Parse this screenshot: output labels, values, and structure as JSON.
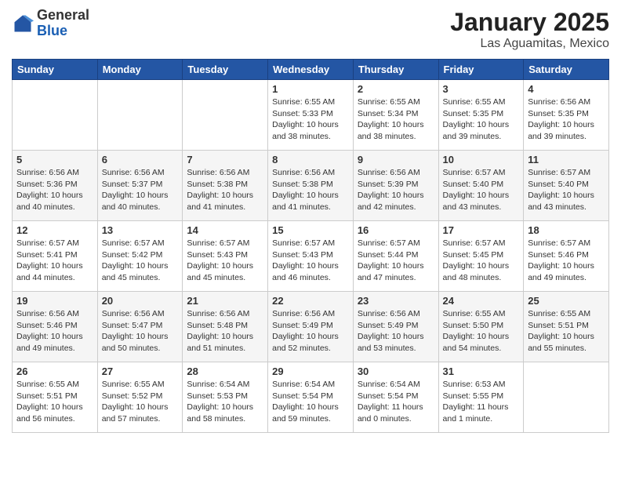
{
  "header": {
    "logo_general": "General",
    "logo_blue": "Blue",
    "month_title": "January 2025",
    "location": "Las Aguamitas, Mexico"
  },
  "days_of_week": [
    "Sunday",
    "Monday",
    "Tuesday",
    "Wednesday",
    "Thursday",
    "Friday",
    "Saturday"
  ],
  "weeks": [
    [
      {
        "day": "",
        "info": ""
      },
      {
        "day": "",
        "info": ""
      },
      {
        "day": "",
        "info": ""
      },
      {
        "day": "1",
        "info": "Sunrise: 6:55 AM\nSunset: 5:33 PM\nDaylight: 10 hours\nand 38 minutes."
      },
      {
        "day": "2",
        "info": "Sunrise: 6:55 AM\nSunset: 5:34 PM\nDaylight: 10 hours\nand 38 minutes."
      },
      {
        "day": "3",
        "info": "Sunrise: 6:55 AM\nSunset: 5:35 PM\nDaylight: 10 hours\nand 39 minutes."
      },
      {
        "day": "4",
        "info": "Sunrise: 6:56 AM\nSunset: 5:35 PM\nDaylight: 10 hours\nand 39 minutes."
      }
    ],
    [
      {
        "day": "5",
        "info": "Sunrise: 6:56 AM\nSunset: 5:36 PM\nDaylight: 10 hours\nand 40 minutes."
      },
      {
        "day": "6",
        "info": "Sunrise: 6:56 AM\nSunset: 5:37 PM\nDaylight: 10 hours\nand 40 minutes."
      },
      {
        "day": "7",
        "info": "Sunrise: 6:56 AM\nSunset: 5:38 PM\nDaylight: 10 hours\nand 41 minutes."
      },
      {
        "day": "8",
        "info": "Sunrise: 6:56 AM\nSunset: 5:38 PM\nDaylight: 10 hours\nand 41 minutes."
      },
      {
        "day": "9",
        "info": "Sunrise: 6:56 AM\nSunset: 5:39 PM\nDaylight: 10 hours\nand 42 minutes."
      },
      {
        "day": "10",
        "info": "Sunrise: 6:57 AM\nSunset: 5:40 PM\nDaylight: 10 hours\nand 43 minutes."
      },
      {
        "day": "11",
        "info": "Sunrise: 6:57 AM\nSunset: 5:40 PM\nDaylight: 10 hours\nand 43 minutes."
      }
    ],
    [
      {
        "day": "12",
        "info": "Sunrise: 6:57 AM\nSunset: 5:41 PM\nDaylight: 10 hours\nand 44 minutes."
      },
      {
        "day": "13",
        "info": "Sunrise: 6:57 AM\nSunset: 5:42 PM\nDaylight: 10 hours\nand 45 minutes."
      },
      {
        "day": "14",
        "info": "Sunrise: 6:57 AM\nSunset: 5:43 PM\nDaylight: 10 hours\nand 45 minutes."
      },
      {
        "day": "15",
        "info": "Sunrise: 6:57 AM\nSunset: 5:43 PM\nDaylight: 10 hours\nand 46 minutes."
      },
      {
        "day": "16",
        "info": "Sunrise: 6:57 AM\nSunset: 5:44 PM\nDaylight: 10 hours\nand 47 minutes."
      },
      {
        "day": "17",
        "info": "Sunrise: 6:57 AM\nSunset: 5:45 PM\nDaylight: 10 hours\nand 48 minutes."
      },
      {
        "day": "18",
        "info": "Sunrise: 6:57 AM\nSunset: 5:46 PM\nDaylight: 10 hours\nand 49 minutes."
      }
    ],
    [
      {
        "day": "19",
        "info": "Sunrise: 6:56 AM\nSunset: 5:46 PM\nDaylight: 10 hours\nand 49 minutes."
      },
      {
        "day": "20",
        "info": "Sunrise: 6:56 AM\nSunset: 5:47 PM\nDaylight: 10 hours\nand 50 minutes."
      },
      {
        "day": "21",
        "info": "Sunrise: 6:56 AM\nSunset: 5:48 PM\nDaylight: 10 hours\nand 51 minutes."
      },
      {
        "day": "22",
        "info": "Sunrise: 6:56 AM\nSunset: 5:49 PM\nDaylight: 10 hours\nand 52 minutes."
      },
      {
        "day": "23",
        "info": "Sunrise: 6:56 AM\nSunset: 5:49 PM\nDaylight: 10 hours\nand 53 minutes."
      },
      {
        "day": "24",
        "info": "Sunrise: 6:55 AM\nSunset: 5:50 PM\nDaylight: 10 hours\nand 54 minutes."
      },
      {
        "day": "25",
        "info": "Sunrise: 6:55 AM\nSunset: 5:51 PM\nDaylight: 10 hours\nand 55 minutes."
      }
    ],
    [
      {
        "day": "26",
        "info": "Sunrise: 6:55 AM\nSunset: 5:51 PM\nDaylight: 10 hours\nand 56 minutes."
      },
      {
        "day": "27",
        "info": "Sunrise: 6:55 AM\nSunset: 5:52 PM\nDaylight: 10 hours\nand 57 minutes."
      },
      {
        "day": "28",
        "info": "Sunrise: 6:54 AM\nSunset: 5:53 PM\nDaylight: 10 hours\nand 58 minutes."
      },
      {
        "day": "29",
        "info": "Sunrise: 6:54 AM\nSunset: 5:54 PM\nDaylight: 10 hours\nand 59 minutes."
      },
      {
        "day": "30",
        "info": "Sunrise: 6:54 AM\nSunset: 5:54 PM\nDaylight: 11 hours\nand 0 minutes."
      },
      {
        "day": "31",
        "info": "Sunrise: 6:53 AM\nSunset: 5:55 PM\nDaylight: 11 hours\nand 1 minute."
      },
      {
        "day": "",
        "info": ""
      }
    ]
  ]
}
